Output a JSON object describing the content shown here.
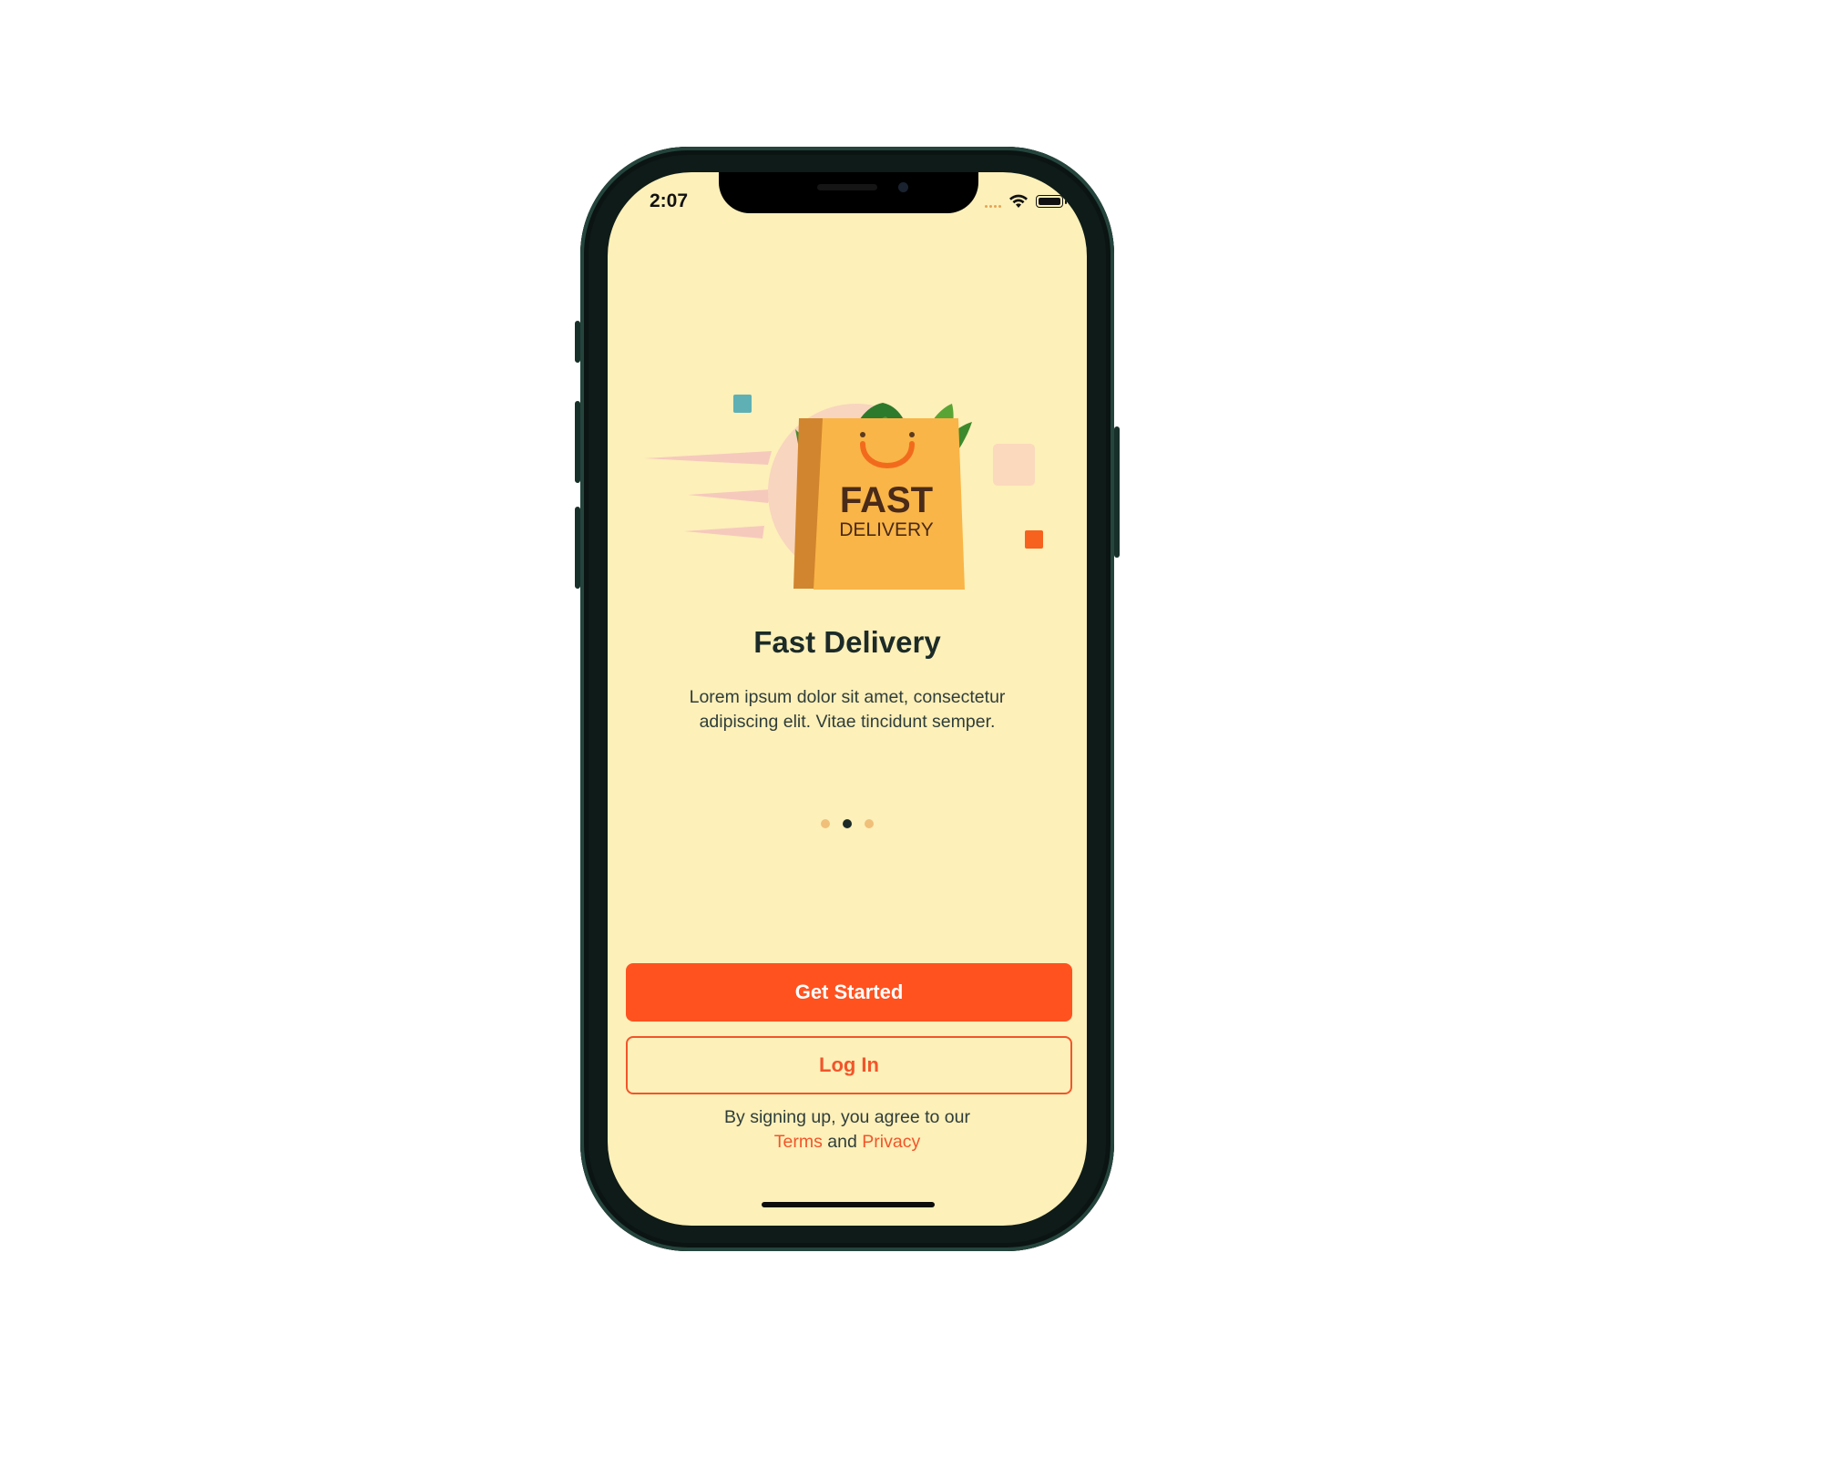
{
  "status_bar": {
    "time": "2:07"
  },
  "onboarding": {
    "illustration": {
      "bag_text_line1": "FAST",
      "bag_text_line2": "DELIVERY"
    },
    "title": "Fast Delivery",
    "description": "Lorem ipsum dolor sit amet, consectetur adipiscing elit. Vitae tincidunt semper.",
    "pager": {
      "total": 3,
      "current_index": 1
    }
  },
  "actions": {
    "get_started_label": "Get Started",
    "login_label": "Log In"
  },
  "legal": {
    "prefix": "By signing up, you agree to our",
    "terms_label": "Terms",
    "conjunction": "and",
    "privacy_label": "Privacy"
  },
  "colors": {
    "screen_background": "#fdf0b9",
    "primary": "#ff521f",
    "text_dark": "#1c2b28",
    "pager_inactive": "#f0bf7a",
    "bag": "#f9b547"
  }
}
